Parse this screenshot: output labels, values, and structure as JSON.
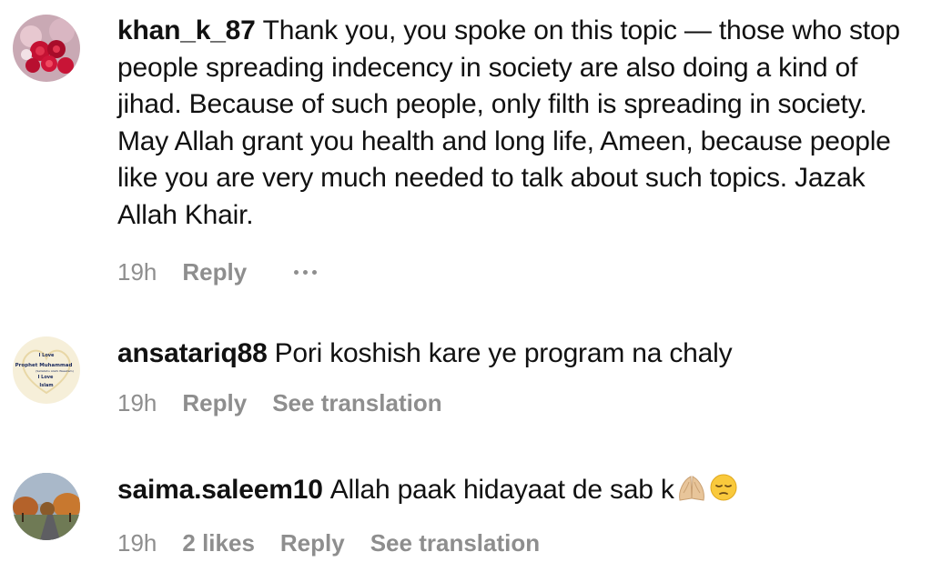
{
  "comments": [
    {
      "username": "khan_k_87",
      "text": "Thank you, you spoke on this topic — those who stop people spreading indecency in society are also doing a kind of jihad. Because of such people, only filth is spreading in society. May Allah grant you health and long life, Ameen, because people like you are very much needed to talk about such topics. Jazak Allah Khair.",
      "time": "19h",
      "reply_label": "Reply",
      "avatar": "red-roses-avatar"
    },
    {
      "username": "ansatariq88",
      "text": "Pori koshish kare ye program na chaly",
      "time": "19h",
      "reply_label": "Reply",
      "translation_label": "See translation",
      "avatar": "heart-text-avatar",
      "avatar_text": [
        "I Love",
        "Prophet Muhammad",
        "(Sallallahu Alaihi Wasallam)",
        "I Love",
        "Islam"
      ]
    },
    {
      "username": "saima.saleem10",
      "text": "Allah paak hidayaat de sab k",
      "emojis": [
        "folded-hands-emoji",
        "pensive-face-emoji"
      ],
      "time": "19h",
      "likes": "2 likes",
      "reply_label": "Reply",
      "translation_label": "See translation",
      "avatar": "autumn-road-avatar"
    }
  ],
  "colors": {
    "text": "#111111",
    "meta": "#8e8e8e",
    "background": "#ffffff"
  }
}
